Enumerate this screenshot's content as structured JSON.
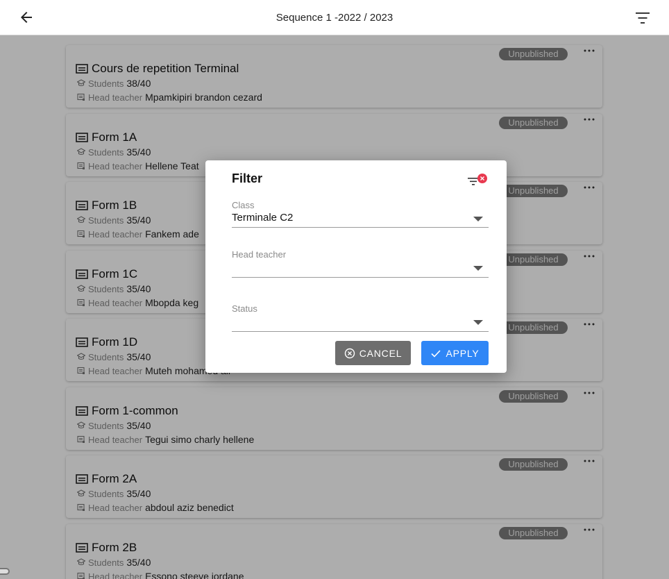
{
  "header": {
    "title": "Sequence 1 -2022 / 2023",
    "back_icon": "arrow-left-icon",
    "filter_icon": "filter-icon"
  },
  "labels": {
    "students": "Students",
    "head_teacher": "Head teacher"
  },
  "classes": [
    {
      "name": "Cours de repetition Terminal",
      "students": "38/40",
      "head_teacher": "Mpamkipiri brandon cezard",
      "status": "Unpublished"
    },
    {
      "name": "Form 1A",
      "students": "35/40",
      "head_teacher": "Hellene Teat",
      "status": "Unpublished"
    },
    {
      "name": "Form 1B",
      "students": "35/40",
      "head_teacher": "Fankem ade",
      "status": "Unpublished"
    },
    {
      "name": "Form 1C",
      "students": "35/40",
      "head_teacher": "Mbopda keg",
      "status": "Unpublished"
    },
    {
      "name": "Form 1D",
      "students": "35/40",
      "head_teacher": "Muteh mohamed ali",
      "status": "Unpublished"
    },
    {
      "name": "Form 1-common",
      "students": "35/40",
      "head_teacher": "Tegui simo charly hellene",
      "status": "Unpublished"
    },
    {
      "name": "Form 2A",
      "students": "35/40",
      "head_teacher": "abdoul aziz benedict",
      "status": "Unpublished"
    },
    {
      "name": "Form 2B",
      "students": "35/40",
      "head_teacher": "Essono steeve jordane",
      "status": "Unpublished"
    }
  ],
  "filter_dialog": {
    "title": "Filter",
    "class_label": "Class",
    "class_value": "Terminale C2",
    "head_teacher_label": "Head teacher",
    "head_teacher_value": "",
    "status_label": "Status",
    "status_value": "",
    "cancel_label": "CANCEL",
    "apply_label": "APPLY"
  },
  "colors": {
    "apply": "#2f86f6",
    "cancel": "#6e6e6e",
    "badge": "#7d7d7d",
    "clear_badge": "#e8394f"
  }
}
